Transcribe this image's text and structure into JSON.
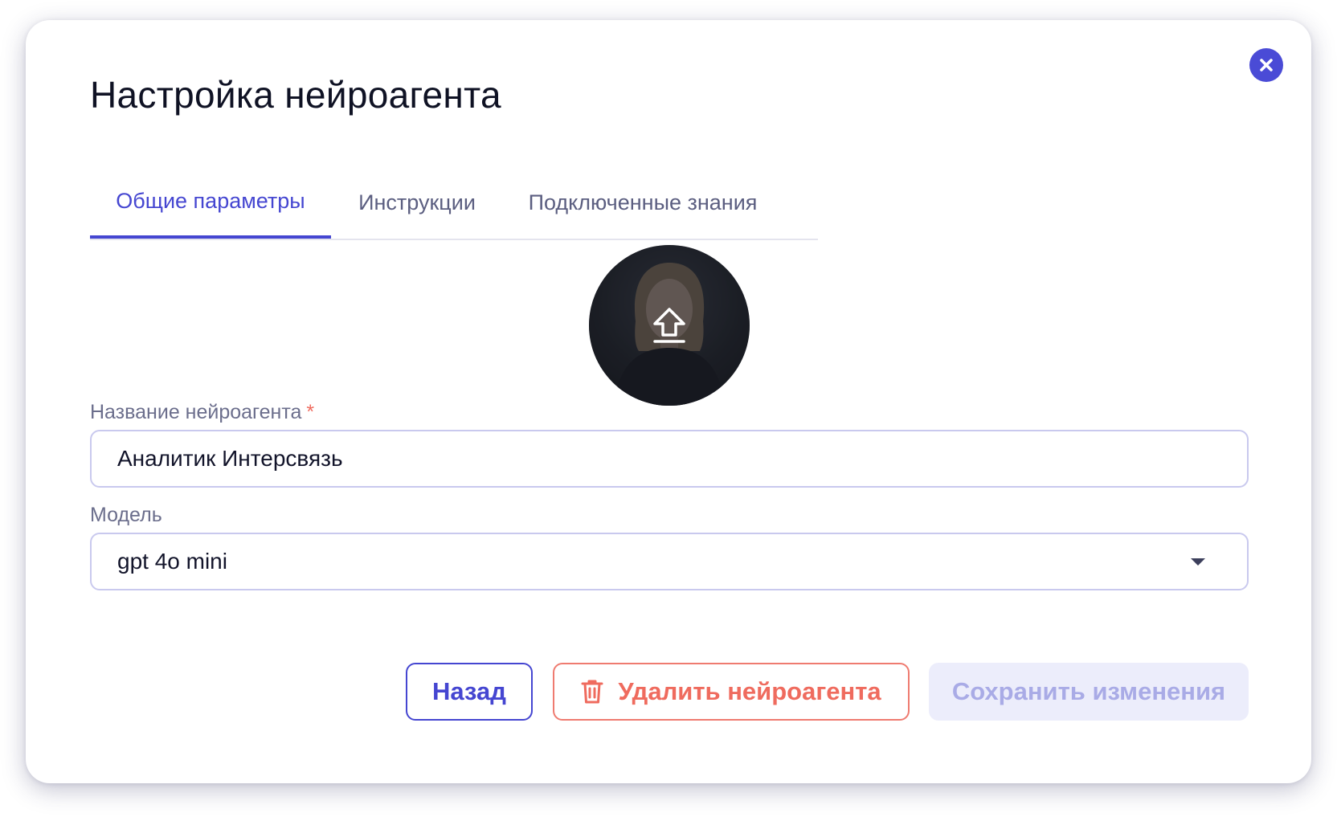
{
  "modal": {
    "title": "Настройка нейроагента",
    "close_icon": "close-icon"
  },
  "tabs": [
    {
      "label": "Общие параметры",
      "active": true
    },
    {
      "label": "Инструкции",
      "active": false
    },
    {
      "label": "Подключенные знания",
      "active": false
    }
  ],
  "avatar": {
    "icon": "upload-icon"
  },
  "form": {
    "name_label": "Название нейроагента",
    "required_mark": "*",
    "name_value": "Аналитик Интерсвязь",
    "model_label": "Модель",
    "model_value": "gpt 4o mini"
  },
  "actions": {
    "back_label": "Назад",
    "delete_label": "Удалить нейроагента",
    "save_label": "Сохранить изменения"
  },
  "colors": {
    "accent": "#4546d1",
    "danger": "#ef6b5e",
    "disabled_bg": "#ecedfb",
    "disabled_text": "#a9abe6"
  }
}
